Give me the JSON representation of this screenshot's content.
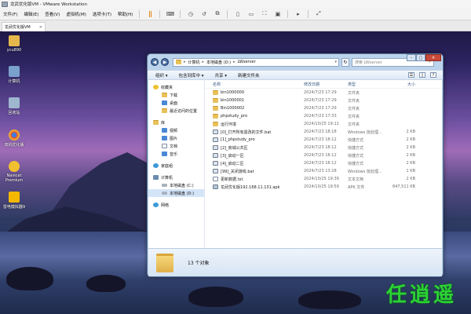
{
  "vm": {
    "title": "龙武优化版VM - VMware Workstation",
    "menu": [
      "文件(F)",
      "编辑(E)",
      "查看(V)",
      "虚拟机(M)",
      "选项卡(T)",
      "帮助(H)"
    ],
    "tab_label": "龙武优化版VM"
  },
  "desktop_icons": [
    {
      "label": "ycu890",
      "icon": "folder-user-icon",
      "color": "#e6b84c"
    },
    {
      "label": "计算机",
      "icon": "computer-icon",
      "color": "#7aa0cc"
    },
    {
      "label": "回收站",
      "icon": "recycle-bin-icon",
      "color": "#9fb6cf"
    },
    {
      "label": "双机优化版",
      "icon": "chrome-icon",
      "color": "#e04a3a"
    },
    {
      "label": "Navicat Premium",
      "icon": "navicat-icon",
      "color": "#f0c030"
    },
    {
      "label": "雷电模拟器9",
      "icon": "ldplayer-icon",
      "color": "#f5b800"
    }
  ],
  "explorer": {
    "address": [
      "计算机",
      "本地磁盘 (D:)",
      "LWserver"
    ],
    "search_placeholder": "搜索 LWserver",
    "toolbar": {
      "organize": "组织 ▾",
      "include": "包含到库中 ▾",
      "share": "共享 ▾",
      "new_folder": "新建文件夹"
    },
    "nav": {
      "favorites": {
        "head": "收藏夹",
        "items": [
          "下载",
          "桌面",
          "最近访问的位置"
        ]
      },
      "libraries": {
        "head": "库",
        "items": [
          "视频",
          "图片",
          "文档",
          "音乐"
        ]
      },
      "homegroup": "家庭组",
      "computer": {
        "head": "计算机",
        "items": [
          "本地磁盘 (C:)",
          "本地磁盘 (D:)"
        ]
      },
      "network": "网络"
    },
    "columns": {
      "name": "名称",
      "date": "修改日期",
      "type": "类型",
      "size": "大小"
    },
    "files": [
      {
        "name": "bin1000000",
        "date": "2024/7/23 17:29",
        "type": "文件夹",
        "size": "",
        "icon": "folder"
      },
      {
        "name": "bin1000001",
        "date": "2024/7/23 17:29",
        "type": "文件夹",
        "size": "",
        "icon": "folder"
      },
      {
        "name": "Bin1000002",
        "date": "2024/7/23 17:29",
        "type": "文件夹",
        "size": "",
        "icon": "folder"
      },
      {
        "name": "phpstudy_pro",
        "date": "2024/7/23 17:33",
        "type": "文件夹",
        "size": "",
        "icon": "folder"
      },
      {
        "name": "运行环境",
        "date": "2024/10/25 19:11",
        "type": "文件夹",
        "size": "",
        "icon": "folder"
      },
      {
        "name": "[0]_打开所有需改的文件.bat",
        "date": "2024/7/23 18:18",
        "type": "Windows 批处理...",
        "size": "2 KB",
        "icon": "bat"
      },
      {
        "name": "[1]_phpstudy_pro",
        "date": "2024/7/23 18:12",
        "type": "快捷方式",
        "size": "2 KB",
        "icon": "bat"
      },
      {
        "name": "[2]_商城公共区",
        "date": "2024/7/23 18:12",
        "type": "快捷方式",
        "size": "2 KB",
        "icon": "bat"
      },
      {
        "name": "[3]_启动一区",
        "date": "2024/7/23 18:12",
        "type": "快捷方式",
        "size": "2 KB",
        "icon": "bat"
      },
      {
        "name": "[4]_启动二区",
        "date": "2024/7/23 18:12",
        "type": "快捷方式",
        "size": "2 KB",
        "icon": "bat"
      },
      {
        "name": "[99]_关闭游戏.bat",
        "date": "2024/7/23 13:28",
        "type": "Windows 批处理...",
        "size": "1 KB",
        "icon": "bat"
      },
      {
        "name": "更新数据.txt",
        "date": "2024/10/25 19:39",
        "type": "文本文档",
        "size": "2 KB",
        "icon": "doc"
      },
      {
        "name": "龙武优化版192.168.11.131.apk",
        "date": "2024/10/25 19:59",
        "type": "APK 文件",
        "size": "847,511 KB",
        "icon": "apk"
      }
    ],
    "status": "13 个对象"
  },
  "watermark": [
    "任",
    "逍",
    "遥"
  ]
}
